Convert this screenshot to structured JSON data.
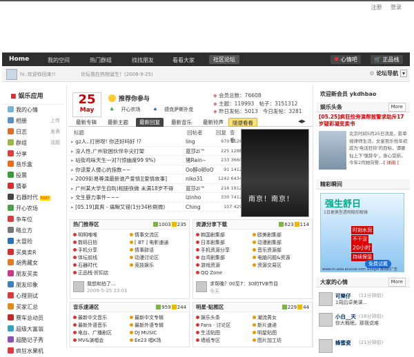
{
  "toplinks": {
    "register": "注册",
    "login": "登录"
  },
  "nav": {
    "logo": "Home",
    "items": [
      "我的空间",
      "热门群组",
      "找找朋友",
      "看看大家",
      "社区论坛"
    ],
    "mood_btn": "心情吧",
    "shop_btn": "正品栈"
  },
  "subbar": {
    "greeting": "hi..欢迎你回来!!",
    "notice": "论坛我在热物诞生！(2008-9-25)",
    "forum_nav": "论坛导航"
  },
  "sidebar": {
    "title": "娱乐应用",
    "items": [
      {
        "label": "我的心情",
        "sub": "",
        "color": "#7ab3d9"
      },
      {
        "label": "相册",
        "sub": "上传",
        "color": "#5c8fc4"
      },
      {
        "label": "日志",
        "sub": "发表",
        "color": "#e06b2a"
      },
      {
        "label": "群组",
        "sub": "话题",
        "color": "#9bb64b"
      },
      {
        "label": "分享",
        "sub": "",
        "color": "#e23d3d"
      },
      {
        "label": "音乐盒",
        "sub": "",
        "color": "#ef6a1a"
      },
      {
        "label": "投票",
        "sub": "",
        "color": "#3b9a3b"
      },
      {
        "label": "猜拳",
        "sub": "",
        "color": "#db2b2b"
      },
      {
        "label": "石器时代",
        "sub": "",
        "color": "#444",
        "hot": "Hot!"
      },
      {
        "label": "开心农场",
        "sub": "",
        "color": "#4aa14a"
      },
      {
        "label": "争车位",
        "sub": "",
        "color": "#d93d3d"
      },
      {
        "label": "略立方",
        "sub": "",
        "color": "#777"
      },
      {
        "label": "大冒险",
        "sub": "",
        "color": "#2c71be"
      },
      {
        "label": "买奥卖R",
        "sub": "",
        "color": "#d2312f"
      },
      {
        "label": "胡秀藏女",
        "sub": "",
        "color": "#e57a24"
      },
      {
        "label": "朋友买卖",
        "sub": "",
        "color": "#c93a84"
      },
      {
        "label": "朋友印象",
        "sub": "",
        "color": "#3c80c2"
      },
      {
        "label": "心理测试",
        "sub": "",
        "color": "#d93a3a"
      },
      {
        "label": "买家汇总",
        "sub": "",
        "color": "#e28b1c"
      },
      {
        "label": "赛车总动员",
        "sub": "",
        "color": "#be2c2c"
      },
      {
        "label": "超级大富翁",
        "sub": "",
        "color": "#3aa1c4"
      },
      {
        "label": "超酷记子秀",
        "sub": "",
        "color": "#8852b6"
      },
      {
        "label": "疯狂水果机",
        "sub": "",
        "color": "#dd3a3a"
      }
    ]
  },
  "center": {
    "calendar": {
      "day": "25",
      "month": "May"
    },
    "recommend": {
      "title": "推荐你参与",
      "items": [
        "开心农场",
        "德克萨斯扑克"
      ]
    },
    "stats": {
      "members": "会员总数：76608",
      "topics": "主题：119993",
      "posts": "帖子：3151312",
      "yesterday": "昨日发帖：5013",
      "today": "今日发帖：3281"
    },
    "tabs": [
      "最新专辑",
      "最新主题",
      "最新回复",
      "最新音乐",
      "最新铃声",
      "随便看看"
    ],
    "thead": {
      "title": "标题",
      "poster": "回帖者",
      "reply": "回复",
      "view": "查看"
    },
    "threads": [
      {
        "title": "gz人..打拼呀! 你还好吗好 !?",
        "author": "ling",
        "nums": "970  1526  6"
      },
      {
        "title": "没人性.广州软困伙伴伞尖打架",
        "author": "蓝莎zi™",
        "nums": "225  1285"
      },
      {
        "title": "站街鸡咏天生一对?(惊幽度99 9%)",
        "author": "猪Rain--",
        "nums": "233  3660"
      },
      {
        "title": "你谅爱人傻心的指数~~",
        "author": "Oo醉o卵oO",
        "nums": "91  1412"
      },
      {
        "title": "2009彩易尊演最新谁产爱情][爱情故事]",
        "author": "niko31",
        "nums": "1242  6434"
      },
      {
        "title": "广州某大学生自Bj)相册铁做  未满18岁不得",
        "author": "蓝莎zi™",
        "nums": "216  1912"
      },
      {
        "title": "文生暴力事件~~~",
        "author": "lzinho",
        "nums": "330  7412"
      },
      {
        "title": "[05.19]真爽 - 痛瞅又错(1分34秒刷微)",
        "author": "Ching",
        "nums": "107  429"
      }
    ],
    "poster_text": "南京！南京！",
    "boxes": [
      {
        "title": "热门推荐区",
        "count1": "1003",
        "count2": "235",
        "items": [
          "明明唯唯",
          "情事交流区",
          "数码日拍",
          "[ BT ] 电影速通",
          "手机分享",
          "情事辞话",
          "体坛前线",
          "动漫讨论区",
          "石器时代",
          "竞技娱乐",
          "正品栈·折扣店",
          ""
        ],
        "last_text": "我想和拍了...",
        "last_time": "2009-5-25 23:01"
      },
      {
        "title": "资源分享下载",
        "count1": "623",
        "count2": "114",
        "items": [
          "韩国剧集部",
          "欧美剧集部",
          "日本剧集部",
          "动漫剧集部",
          "手机资源分享",
          "音乐资源部",
          "台湾剧集部",
          "电脑问题&资源",
          "游戏资源",
          "资源交易区",
          "QQ Zone",
          ""
        ],
        "last_text": "求帮晚？00至7：30的TVB节目",
        "last_time": "今天"
      },
      {
        "title": "音乐速递区",
        "count1": "959",
        "count2": "244",
        "items": [
          "最新中文音乐",
          "最新中文专辑",
          "最新外语音乐",
          "最新外语专辑",
          "电台、广播剧区",
          "DJ MUSIC",
          "MV&演唱会",
          "Ee23 唱K场"
        ]
      },
      {
        "title": "明星·贴图区",
        "count1": "229",
        "count2": "44",
        "items": [
          "娱乐头条",
          "潮流男女",
          "Fans · 讨论区",
          "新片速递",
          "生活贴图",
          "明星贴图",
          "墙纸专区",
          "图片加工坊"
        ]
      }
    ]
  },
  "right": {
    "welcome": "欢迎新会员  ykdhbao",
    "headline_title": "娱乐头条",
    "more": "More",
    "headline": "[05.25]疯狂俭旁演帮报警求助斥17岁疑彩凝变卖书",
    "headline_text": "北京时间5月25日消息，影审视律师生活，女星熊乐恰年初成为'电话狂铃'的目标，谭挪仙上下'强辞令'，身心受损，今年2月她向警…",
    "more_link": "[ 详阅 ]",
    "hot_title": "精彩瞬间",
    "ad": {
      "l1": "强生舒日",
      "l2": "1日更换型透明隐形眼镜",
      "l3": "时刻水润",
      "l4": "不干涩",
      "l5": "20小时",
      "l6": "持续保湿",
      "l7": "免费试戴",
      "l8": "www.cn.asia.acuvue.com Google 推测的广告"
    },
    "mood_title": "大家的心情",
    "moods": [
      {
        "name": "可樂仔",
        "time": "(11分钟前)",
        "text": "1周后卓美课..."
      },
      {
        "name": "小白__天",
        "time": "(16分钟前)",
        "text": "你大概眠，那我说难"
      },
      {
        "name": "蜂蜜瓷",
        "time": "(21分钟前)",
        "text": ""
      }
    ]
  }
}
